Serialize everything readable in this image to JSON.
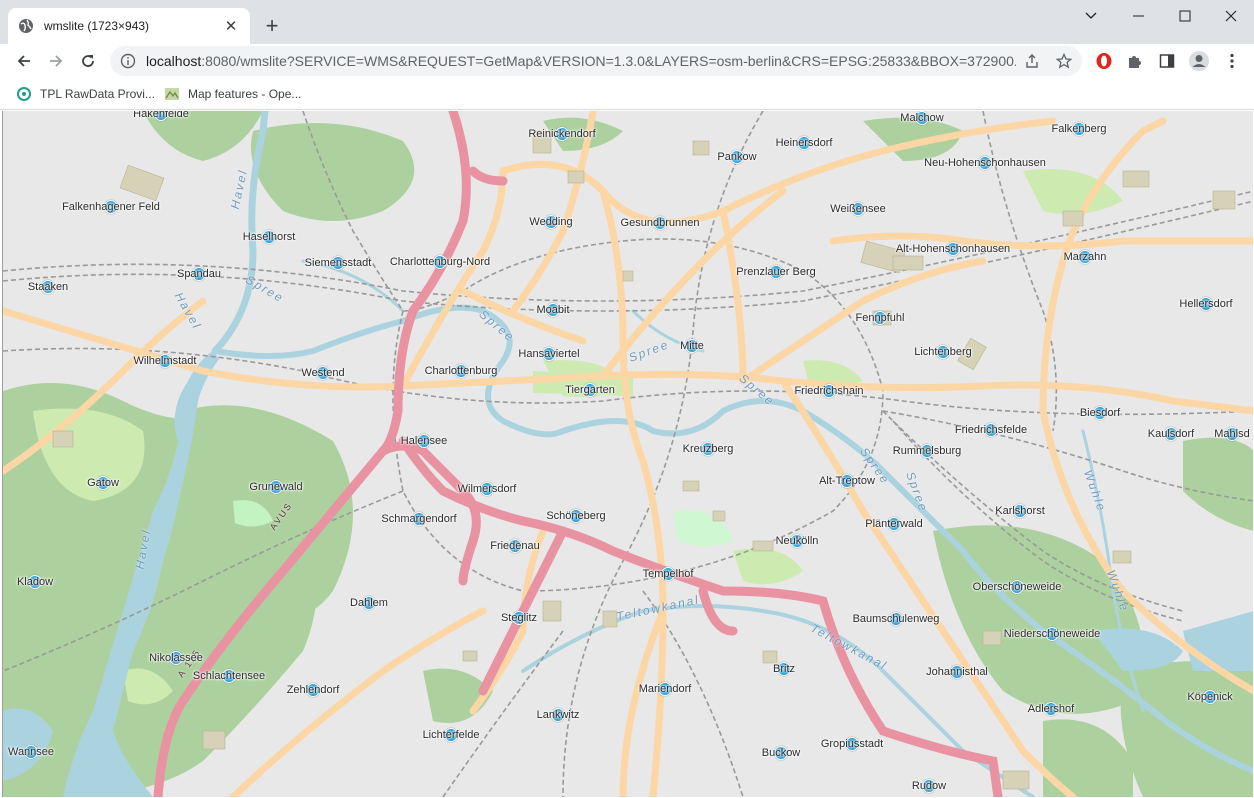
{
  "browser": {
    "tab_title": "wmslite (1723×943)",
    "url_host": "localhost",
    "url_rest": ":8080/wmslite?SERVICE=WMS&REQUEST=GetMap&VERSION=1.3.0&LAYERS=osm-berlin&CRS=EPSG:25833&BBOX=372900.376..."
  },
  "bookmarks": [
    {
      "label": "TPL RawData Provi..."
    },
    {
      "label": "Map features - Ope..."
    }
  ],
  "map": {
    "places": [
      {
        "name": "Hakenfelde"
      },
      {
        "name": "Reinickendorf"
      },
      {
        "name": "Pankow"
      },
      {
        "name": "Heinersdorf"
      },
      {
        "name": "Malchow"
      },
      {
        "name": "Falkenberg"
      },
      {
        "name": "Neu-Hohenschonhausen"
      },
      {
        "name": "Falkenhagener Feld"
      },
      {
        "name": "Wedding"
      },
      {
        "name": "Gesundbrunnen"
      },
      {
        "name": "Weißensee"
      },
      {
        "name": "Haselhorst"
      },
      {
        "name": "Siemensstadt"
      },
      {
        "name": "Charlottenburg-Nord"
      },
      {
        "name": "Alt-Hohenschonhausen"
      },
      {
        "name": "Marzahn"
      },
      {
        "name": "Spandau"
      },
      {
        "name": "Prenzlauer Berg"
      },
      {
        "name": "Staaken"
      },
      {
        "name": "Moabit"
      },
      {
        "name": "Fennpfuhl"
      },
      {
        "name": "Hellersdorf"
      },
      {
        "name": "Mitte"
      },
      {
        "name": "Hansaviertel"
      },
      {
        "name": "Wilhelmstadt"
      },
      {
        "name": "Lichtenberg"
      },
      {
        "name": "Westend"
      },
      {
        "name": "Charlottenburg"
      },
      {
        "name": "Friedrichshain"
      },
      {
        "name": "Tiergarten"
      },
      {
        "name": "Biesdorf"
      },
      {
        "name": "Kaulsdorf"
      },
      {
        "name": "Mahlsd"
      },
      {
        "name": "Friedrichsfelde"
      },
      {
        "name": "Halensee"
      },
      {
        "name": "Kreuzberg"
      },
      {
        "name": "Rummelsburg"
      },
      {
        "name": "Gatow"
      },
      {
        "name": "Grunewald"
      },
      {
        "name": "Alt-Treptow"
      },
      {
        "name": "Wilmersdorf"
      },
      {
        "name": "Karlshorst"
      },
      {
        "name": "Schmargendorf"
      },
      {
        "name": "Schöneberg"
      },
      {
        "name": "Plänterwald"
      },
      {
        "name": "Friedenau"
      },
      {
        "name": "Neukölln"
      },
      {
        "name": "Kladow"
      },
      {
        "name": "Tempelhof"
      },
      {
        "name": "Oberschöneweide"
      },
      {
        "name": "Dahlem"
      },
      {
        "name": "Steglitz"
      },
      {
        "name": "Baumschulenweg"
      },
      {
        "name": "Niederschöneweide"
      },
      {
        "name": "Nikolassee"
      },
      {
        "name": "Britz"
      },
      {
        "name": "Johannisthal"
      },
      {
        "name": "Schlachtensee"
      },
      {
        "name": "Zehlendorf"
      },
      {
        "name": "Mariendorf"
      },
      {
        "name": "Köpenick"
      },
      {
        "name": "Adlershof"
      },
      {
        "name": "Lankwitz"
      },
      {
        "name": "Lichterfelde"
      },
      {
        "name": "Gropiusstadt"
      },
      {
        "name": "Wannsee"
      },
      {
        "name": "Buckow"
      },
      {
        "name": "Rudow"
      }
    ],
    "water_labels": [
      {
        "text": "Havel"
      },
      {
        "text": "Havel"
      },
      {
        "text": "Havel"
      },
      {
        "text": "Spree"
      },
      {
        "text": "Spree"
      },
      {
        "text": "Spree"
      },
      {
        "text": "Spree"
      },
      {
        "text": "Spree"
      },
      {
        "text": "Spree"
      },
      {
        "text": "Teltowkanal"
      },
      {
        "text": "Teltowkanal"
      },
      {
        "text": "Wuhle"
      },
      {
        "text": "Wuhle"
      }
    ],
    "road_labels": [
      {
        "text": "AVUS"
      },
      {
        "text": "A 115"
      }
    ],
    "colors": {
      "background": "#e8e8e8",
      "water": "#aad3df",
      "forest": "#add19e",
      "park": "#c8facc",
      "motorway": "#e892a2",
      "primary": "#fcd6a4",
      "pin": "#2a9fd6"
    }
  }
}
